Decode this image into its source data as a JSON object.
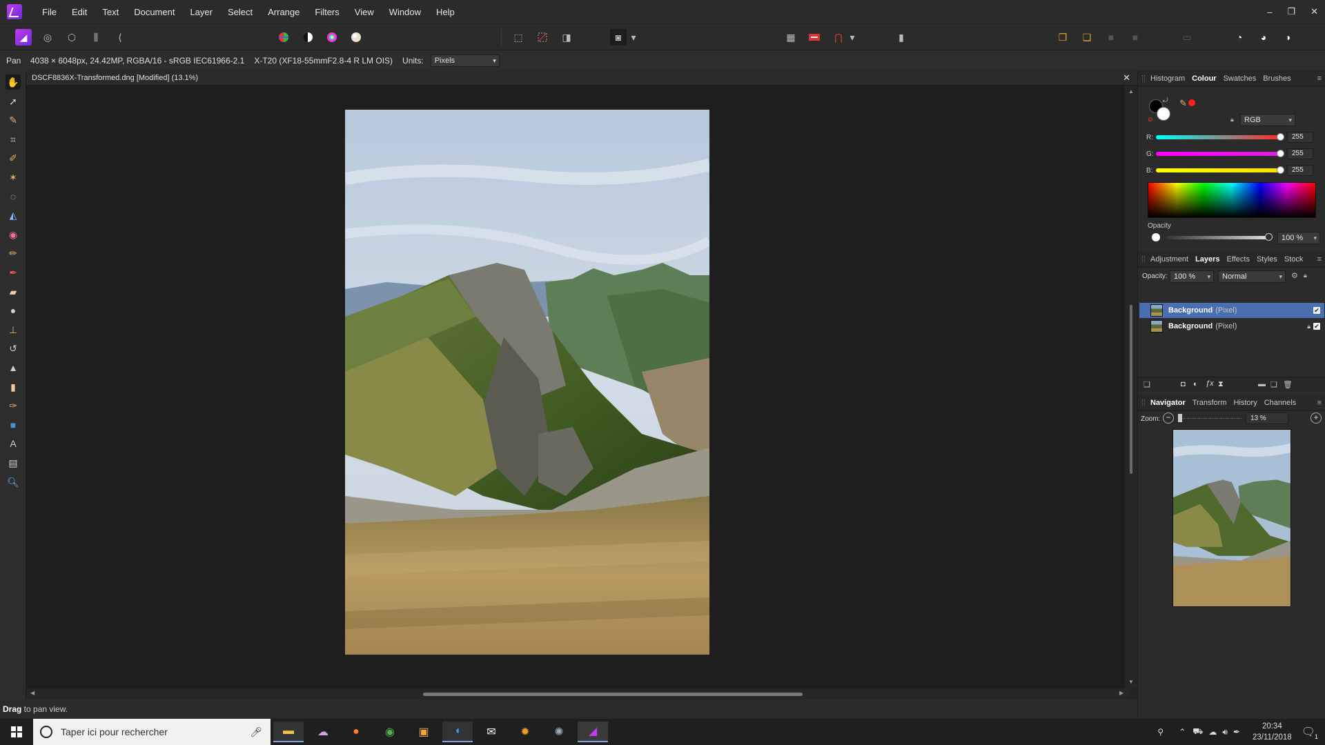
{
  "menubar": {
    "items": [
      "File",
      "Edit",
      "Text",
      "Document",
      "Layer",
      "Select",
      "Arrange",
      "Filters",
      "View",
      "Window",
      "Help"
    ],
    "window_controls": [
      "–",
      "❐",
      "✕"
    ]
  },
  "context": {
    "tool": "Pan",
    "info": "4038 × 6048px, 24.42MP, RGBA/16 - sRGB IEC61966-2.1",
    "camera": "X-T20 (XF18-55mmF2.8-4 R LM OIS)",
    "units_label": "Units:",
    "units_value": "Pixels"
  },
  "document": {
    "tab_title": "DSCF8836X-Transformed.dng [Modified] (13.1%)",
    "close": "✕"
  },
  "status": {
    "bold": "Drag",
    "rest": " to pan view."
  },
  "colour_panel": {
    "tabs": [
      "Histogram",
      "Colour",
      "Swatches",
      "Brushes"
    ],
    "active_tab": "Colour",
    "model": "RGB",
    "channels": [
      {
        "label": "R:",
        "value": "255",
        "color": "#ff2a2a"
      },
      {
        "label": "G:",
        "value": "255",
        "color": "#e020e0"
      },
      {
        "label": "B:",
        "value": "255",
        "color": "#f5e000"
      }
    ],
    "opacity_label": "Opacity",
    "opacity_value": "100 %"
  },
  "layers_panel": {
    "tabs": [
      "Adjustment",
      "Layers",
      "Effects",
      "Styles",
      "Stock"
    ],
    "active_tab": "Layers",
    "opacity_label": "Opacity:",
    "opacity_value": "100 %",
    "blend_mode": "Normal",
    "layers": [
      {
        "name": "Background",
        "type": "(Pixel)",
        "selected": true,
        "locked": false
      },
      {
        "name": "Background",
        "type": "(Pixel)",
        "selected": false,
        "locked": true
      }
    ]
  },
  "navigator_panel": {
    "tabs": [
      "Navigator",
      "Transform",
      "History",
      "Channels"
    ],
    "active_tab": "Navigator",
    "zoom_label": "Zoom:",
    "zoom_value": "13 %"
  },
  "taskbar": {
    "search_placeholder": "Taper ici pour rechercher",
    "time": "20:34",
    "date": "23/11/2018",
    "notification_count": "1"
  },
  "colors": {
    "accent_selected": "#4a6fb0",
    "primary_swatch": "#000000",
    "secondary_swatch": "#ffffff",
    "eyedropper_swatch": "#ff2020"
  }
}
